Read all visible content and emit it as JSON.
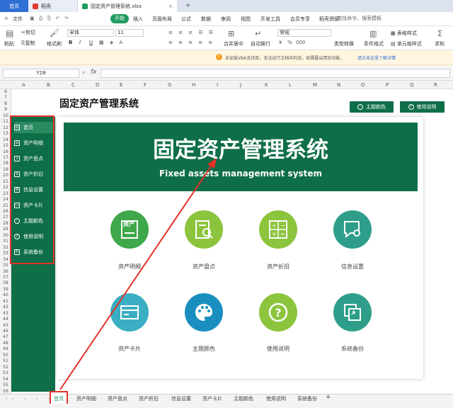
{
  "titlebar": {
    "home_tab": "首页",
    "docer_tab": "稻壳",
    "file_tab": "固定资产管理系统.xlsx",
    "add": "+"
  },
  "menu": {
    "file": "文件",
    "start": "开始",
    "items": [
      "插入",
      "页面布局",
      "公式",
      "数据",
      "审阅",
      "视图",
      "开发工具",
      "会员专享",
      "稻壳资源"
    ],
    "search_placeholder": "查找命令、搜索模板"
  },
  "ribbon": {
    "paste": "粘贴",
    "cut": "剪切",
    "copy": "复制",
    "format_painter": "格式刷",
    "font_name": "宋体",
    "font_size": "11",
    "bold": "B",
    "italic": "I",
    "underline": "U",
    "merge": "合并居中",
    "wrap": "自动换行",
    "number_format": "常规",
    "type_convert": "类型转换",
    "cond_format": "条件格式",
    "table_style": "表格样式",
    "cell_style": "单元格样式",
    "sum": "求和",
    "percent": "%",
    "comma": "000"
  },
  "notice": {
    "text": "未安装VBA支持库，无法运行文档中的宏。如需要启用宏功能，",
    "link": "请点击这里了解详情"
  },
  "formula": {
    "cell_ref": "Y28",
    "fx": "fx"
  },
  "columns": [
    "A",
    "B",
    "C",
    "D",
    "E",
    "F",
    "G",
    "H",
    "I",
    "J",
    "K",
    "L",
    "M",
    "N",
    "O",
    "P",
    "Q",
    "R"
  ],
  "rows": [
    "6",
    "7",
    "8",
    "9",
    "10",
    "11",
    "12",
    "13",
    "14",
    "15",
    "16",
    "17",
    "18",
    "19",
    "20",
    "21",
    "22",
    "23",
    "24",
    "25",
    "26",
    "27",
    "28",
    "29",
    "30",
    "31",
    "32",
    "33",
    "34",
    "35",
    "36",
    "37",
    "38",
    "39",
    "40",
    "41",
    "42",
    "43",
    "44",
    "45",
    "46",
    "47",
    "48",
    "49",
    "50",
    "51",
    "52",
    "53",
    "54",
    "55",
    "56"
  ],
  "app": {
    "title": "固定资产管理系统",
    "theme_btn": "主题颜色",
    "help_btn": "使用说明",
    "banner_cn": "固定资产管理系统",
    "banner_en": "Fixed assets management system"
  },
  "sidebar": {
    "items": [
      "首页",
      "资产明细",
      "资产盘点",
      "资产折旧",
      "信息设置",
      "资产卡片",
      "主题颜色",
      "使用说明",
      "系统备份"
    ]
  },
  "modules": {
    "labels": [
      "资产明细",
      "资产盘点",
      "资产折旧",
      "信息设置",
      "资产卡片",
      "主题颜色",
      "使用说明",
      "系统备份"
    ],
    "icon_text": "资产"
  },
  "sheet_tabs": [
    "首页",
    "资产明细",
    "资产盘点",
    "资产折旧",
    "信息设置",
    "资产卡片",
    "主题颜色",
    "使用说明",
    "系统备份"
  ],
  "colors": {
    "brand_green": "#0e6e48",
    "circle_green": "#3ea84a",
    "circle_lime": "#8cc43d",
    "circle_teal": "#2e9e8a",
    "circle_cyan": "#3aaec2",
    "circle_blue": "#1a8fbf",
    "annotation_red": "#e3322b"
  }
}
